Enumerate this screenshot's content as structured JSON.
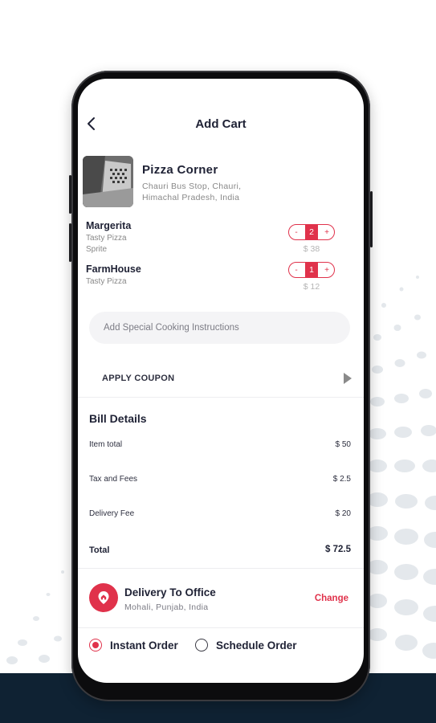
{
  "header": {
    "title": "Add Cart"
  },
  "restaurant": {
    "name": "Pizza Corner",
    "address_line1": "Chauri Bus Stop, Chauri,",
    "address_line2": "Himachal Pradesh, India"
  },
  "items": [
    {
      "name": "Margerita",
      "details": [
        "Tasty Pizza",
        "Sprite"
      ],
      "quantity": "2",
      "price": "$ 38",
      "minus": "-",
      "plus": "+"
    },
    {
      "name": "FarmHouse",
      "details": [
        "Tasty Pizza"
      ],
      "quantity": "1",
      "price": "$ 12",
      "minus": "-",
      "plus": "+"
    }
  ],
  "cooking_instructions": {
    "placeholder": "Add Special Cooking Instructions"
  },
  "coupon": {
    "label": "APPLY COUPON"
  },
  "bill": {
    "title": "Bill Details",
    "rows": [
      {
        "label": "Item total",
        "value": "$ 50"
      },
      {
        "label": "Tax and Fees",
        "value": "$ 2.5"
      },
      {
        "label": "Delivery Fee",
        "value": "$ 20"
      }
    ],
    "total_label": "Total",
    "total_value": "$ 72.5"
  },
  "delivery": {
    "title": "Delivery To Office",
    "address": "Mohali, Punjab, India",
    "change_label": "Change",
    "icon": "home-pin-icon"
  },
  "order_type": {
    "options": [
      {
        "label": "Instant Order",
        "selected": true
      },
      {
        "label": "Schedule Order",
        "selected": false
      }
    ]
  },
  "colors": {
    "accent": "#e0324b",
    "text_dark": "#1f2235",
    "muted": "#888888",
    "footer_band": "#0f2233"
  }
}
